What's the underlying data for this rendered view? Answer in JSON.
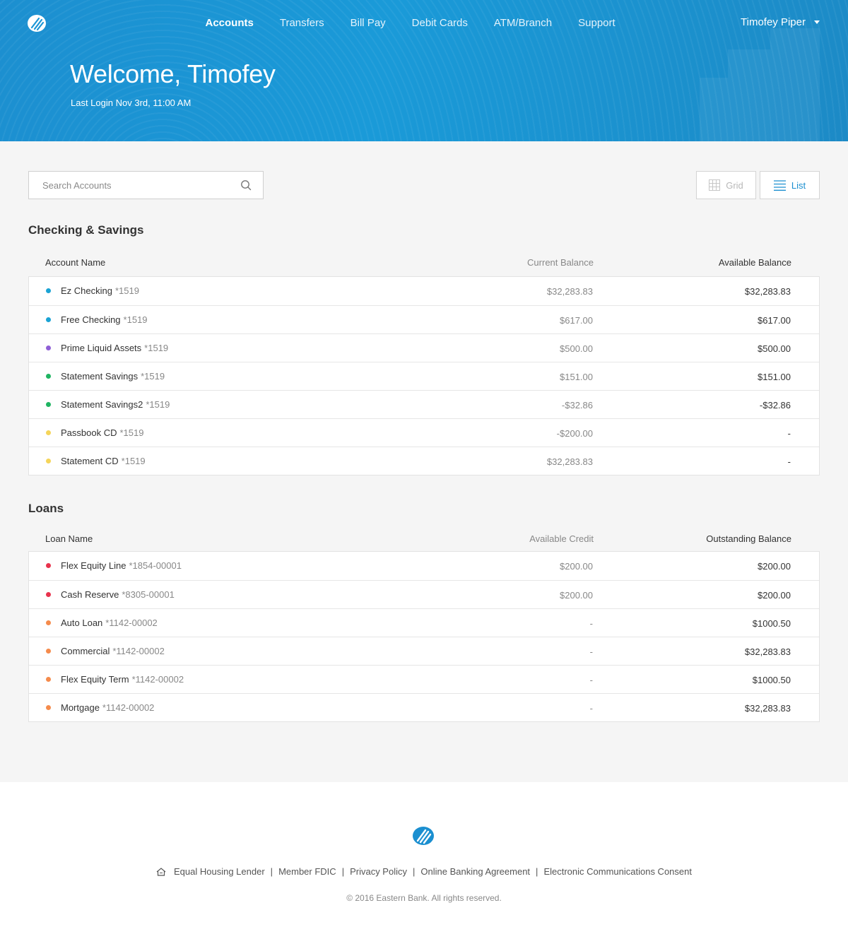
{
  "header": {
    "nav": [
      {
        "label": "Accounts",
        "active": true
      },
      {
        "label": "Transfers",
        "active": false
      },
      {
        "label": "Bill Pay",
        "active": false
      },
      {
        "label": "Debit Cards",
        "active": false
      },
      {
        "label": "ATM/Branch",
        "active": false
      },
      {
        "label": "Support",
        "active": false
      }
    ],
    "user_name": "Timofey Piper",
    "welcome": "Welcome, Timofey",
    "last_login": "Last Login Nov 3rd, 11:00 AM"
  },
  "toolbar": {
    "search_placeholder": "Search Accounts",
    "grid_label": "Grid",
    "list_label": "List"
  },
  "checking": {
    "title": "Checking & Savings",
    "columns": [
      "Account Name",
      "Current Balance",
      "Available Balance"
    ],
    "rows": [
      {
        "name": "Ez Checking",
        "number": "*1519",
        "current": "$32,283.83",
        "available": "$32,283.83",
        "color": "#1aa3d4"
      },
      {
        "name": "Free Checking",
        "number": "*1519",
        "current": "$617.00",
        "available": "$617.00",
        "color": "#1aa3d4"
      },
      {
        "name": "Prime Liquid Assets",
        "number": "*1519",
        "current": "$500.00",
        "available": "$500.00",
        "color": "#8f5fd6"
      },
      {
        "name": "Statement Savings",
        "number": "*1519",
        "current": "$151.00",
        "available": "$151.00",
        "color": "#1fb462"
      },
      {
        "name": "Statement Savings2",
        "number": "*1519",
        "current": "-$32.86",
        "available": "-$32.86",
        "color": "#1fb462"
      },
      {
        "name": "Passbook CD",
        "number": "*1519",
        "current": "-$200.00",
        "available": "-",
        "color": "#f5d55a"
      },
      {
        "name": "Statement CD",
        "number": "*1519",
        "current": "$32,283.83",
        "available": "-",
        "color": "#f5d55a"
      }
    ]
  },
  "loans": {
    "title": "Loans",
    "columns": [
      "Loan Name",
      "Available Credit",
      "Outstanding Balance"
    ],
    "rows": [
      {
        "name": "Flex Equity Line",
        "number": "*1854-00001",
        "credit": "$200.00",
        "balance": "$200.00",
        "color": "#e8334d"
      },
      {
        "name": "Cash Reserve",
        "number": "*8305-00001",
        "credit": "$200.00",
        "balance": "$200.00",
        "color": "#e8334d"
      },
      {
        "name": "Auto Loan",
        "number": "*1142-00002",
        "credit": "-",
        "balance": "$1000.50",
        "color": "#f58b4c"
      },
      {
        "name": "Commercial",
        "number": "*1142-00002",
        "credit": "-",
        "balance": "$32,283.83",
        "color": "#f58b4c"
      },
      {
        "name": "Flex Equity Term",
        "number": "*1142-00002",
        "credit": "-",
        "balance": "$1000.50",
        "color": "#f58b4c"
      },
      {
        "name": "Mortgage",
        "number": "*1142-00002",
        "credit": "-",
        "balance": "$32,283.83",
        "color": "#f58b4c"
      }
    ]
  },
  "footer": {
    "links": [
      "Equal Housing Lender",
      "Member FDIC",
      "Privacy Policy",
      "Online Banking Agreement",
      "Electronic Communications Consent"
    ],
    "copyright": "© 2016 Eastern Bank. All rights reserved."
  },
  "colors": {
    "brand": "#1b8fd0",
    "header_bg": "#1a96d6"
  },
  "icons": [
    "logo-icon",
    "search-icon",
    "grid-icon",
    "list-icon",
    "chevron-down-icon",
    "house-icon"
  ]
}
